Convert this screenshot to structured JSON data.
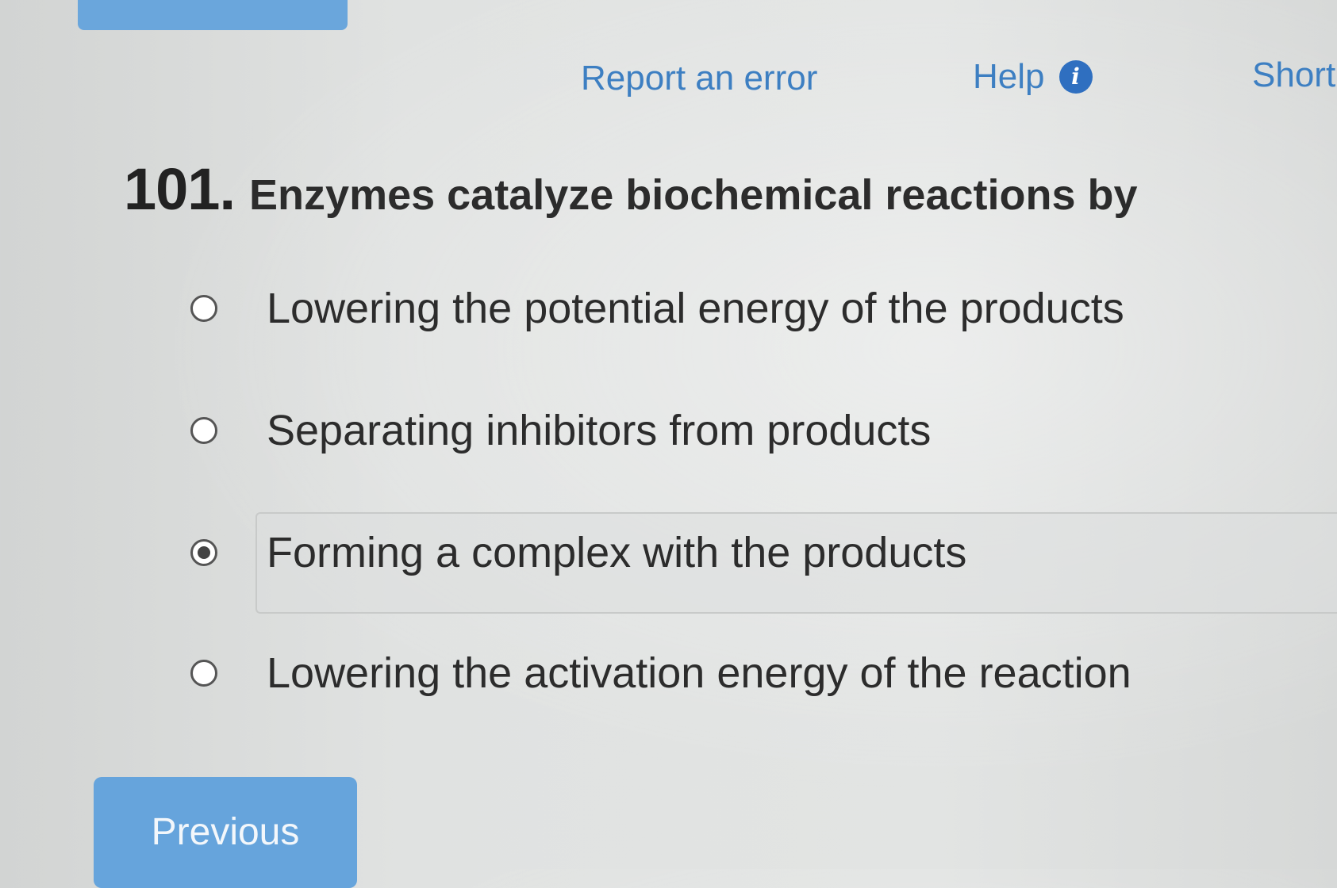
{
  "header": {
    "report_label": "Report an error",
    "help_label": "Help",
    "help_icon_glyph": "i",
    "short_label": "Short"
  },
  "question": {
    "number": "101.",
    "text": "Enzymes catalyze biochemical reactions by",
    "options": [
      {
        "label": "Lowering the potential energy of the products",
        "selected": false
      },
      {
        "label": "Separating inhibitors from products",
        "selected": false
      },
      {
        "label": "Forming a complex with the products",
        "selected": true
      },
      {
        "label": "Lowering the activation energy of the reaction",
        "selected": false
      }
    ]
  },
  "nav": {
    "previous_label": "Previous"
  },
  "colors": {
    "link": "#3d7fc2",
    "button": "#66a4dc",
    "help_icon": "#2f6fc0"
  },
  "icons": {
    "help": "info-circle-icon"
  }
}
